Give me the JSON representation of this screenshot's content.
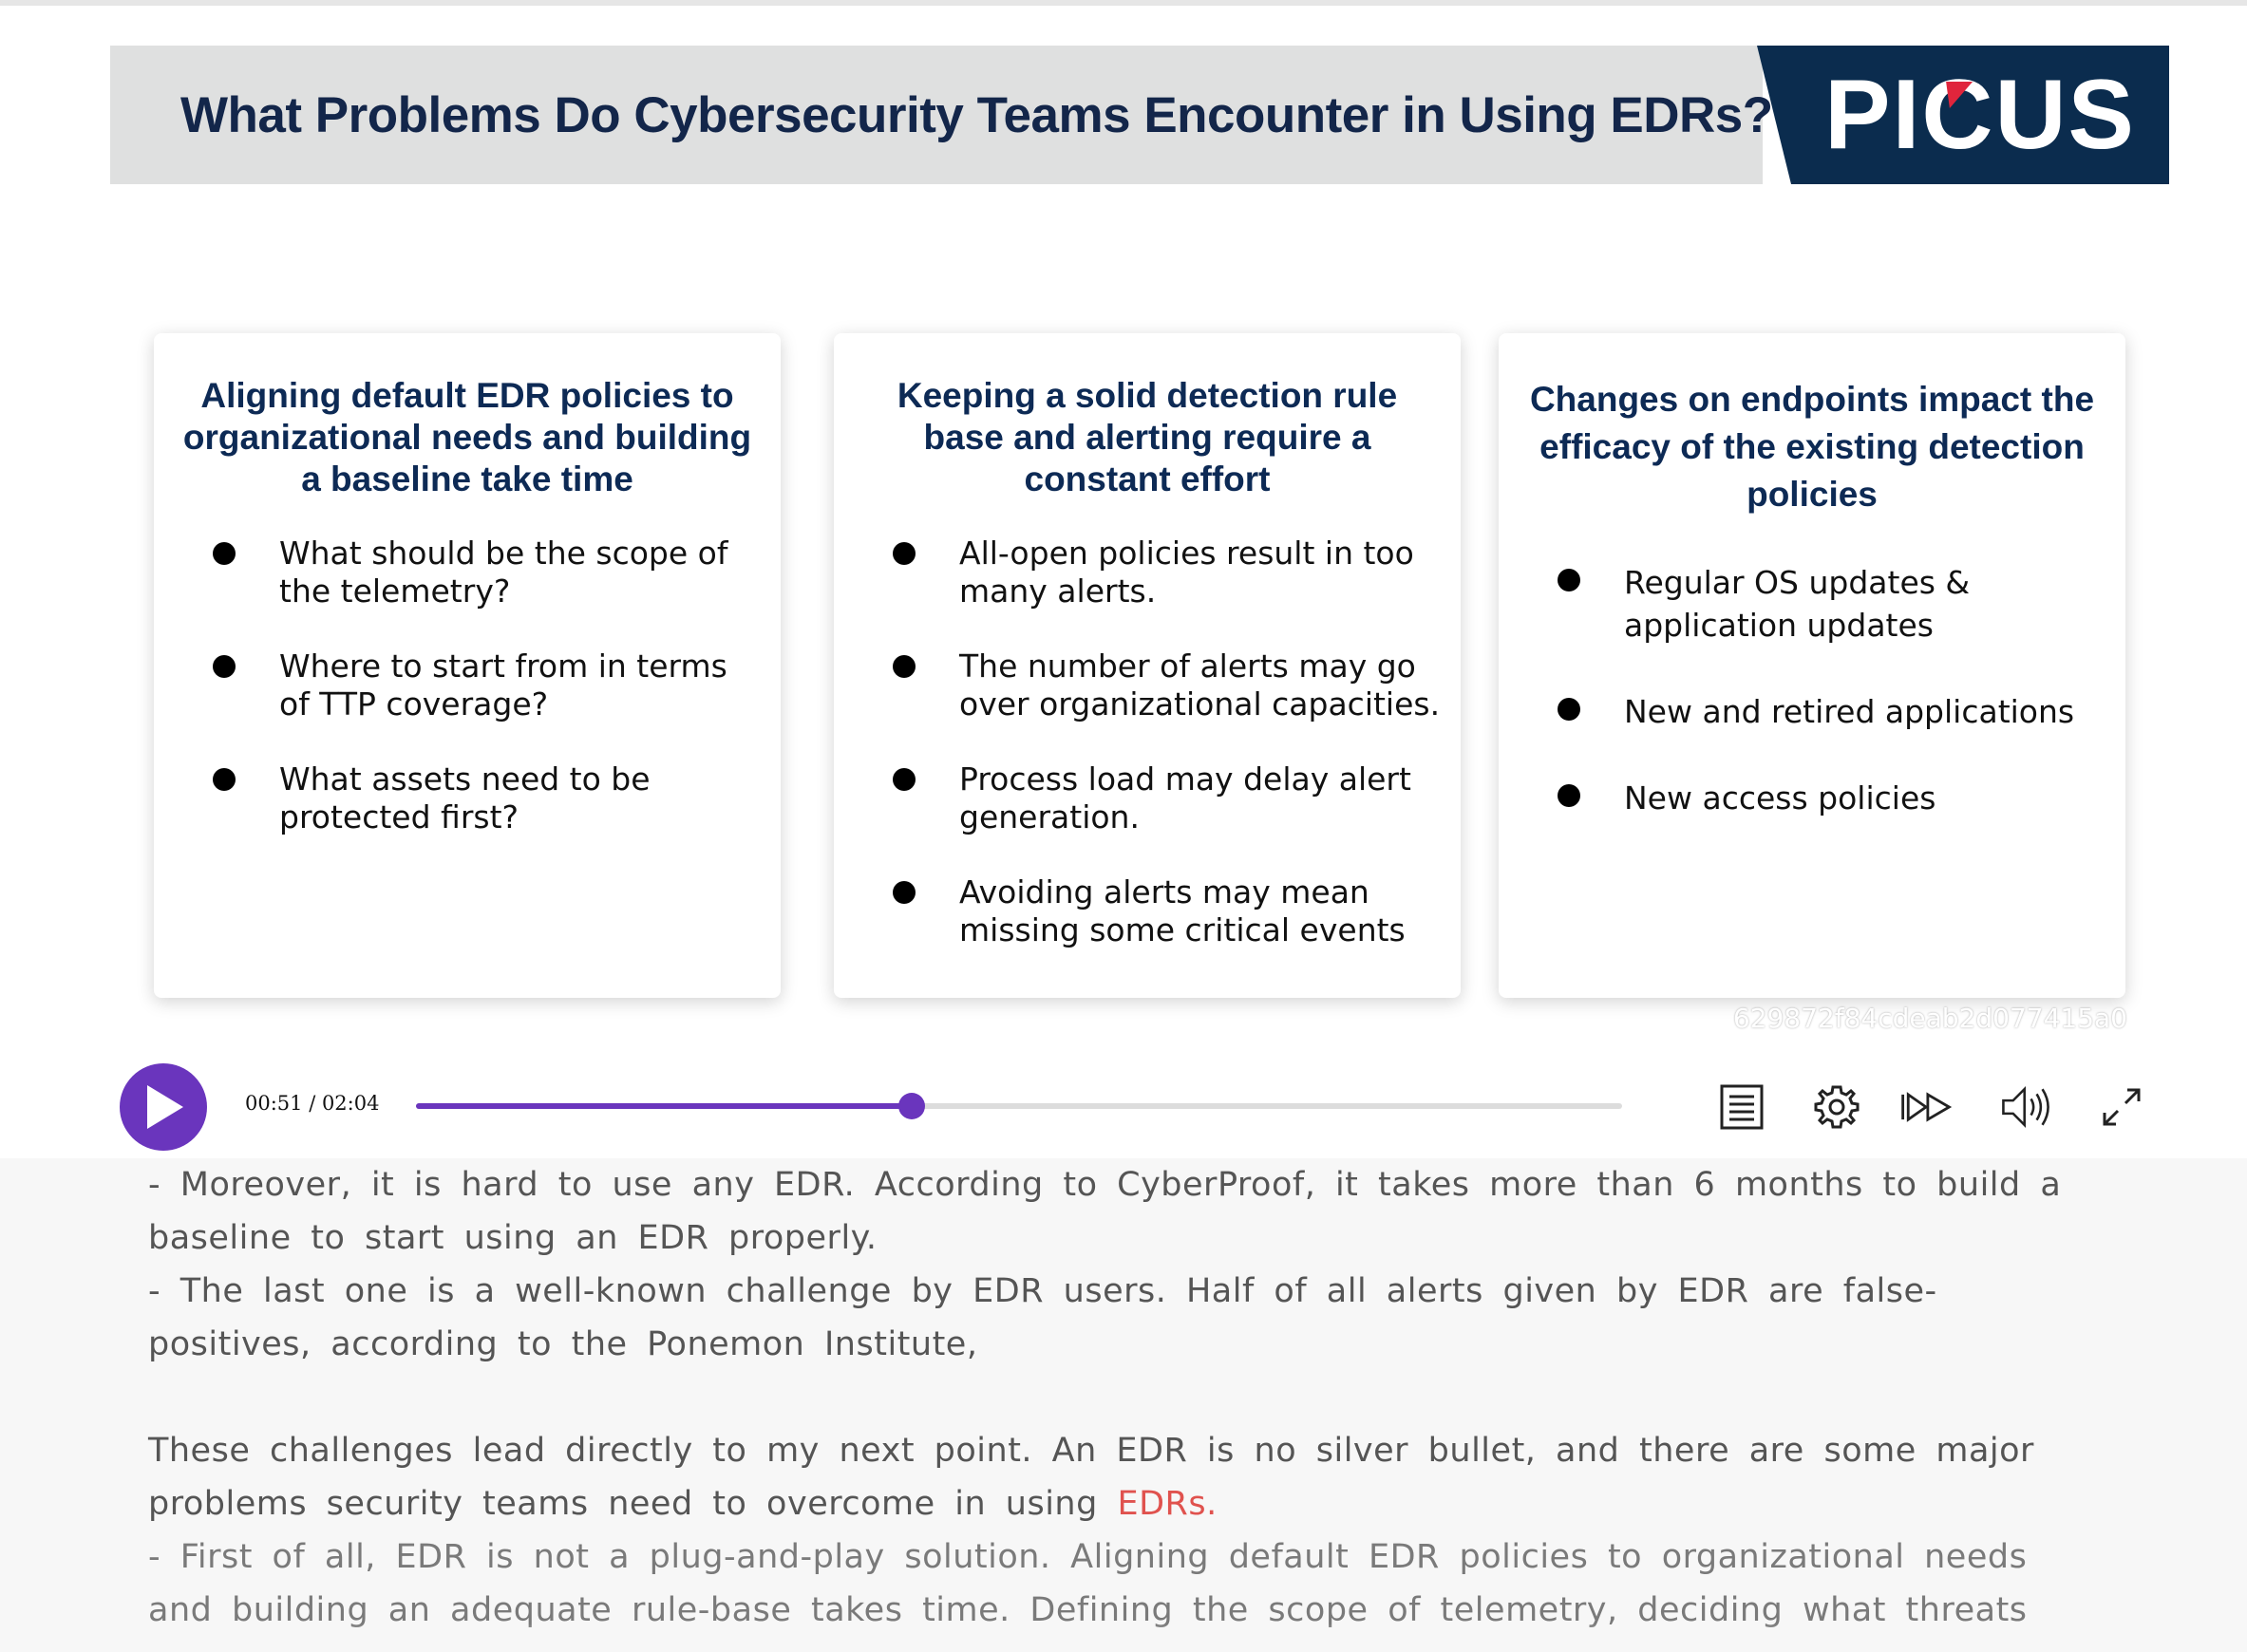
{
  "slide": {
    "title": "What Problems Do Cybersecurity Teams Encounter in Using EDRs?",
    "logo_text": "PICUS",
    "watermark": "629872f84cdeab2d077415a0",
    "colors": {
      "title_bar_bg": "#dfe0e0",
      "title_text": "#13264a",
      "logo_bg": "#0b2c4e",
      "logo_accent": "#e0253c",
      "card_heading": "#0d2a55"
    },
    "cards": [
      {
        "heading": "Aligning default EDR policies to organizational needs and building a baseline take time",
        "bullets": [
          "What should be the scope of the telemetry?",
          "Where to start from in terms of TTP coverage?",
          "What assets need to be protected first?"
        ]
      },
      {
        "heading": "Keeping a solid detection rule base and alerting require a constant effort",
        "bullets": [
          "All-open policies result in too many alerts.",
          " The number of alerts may go over organizational capacities.",
          "Process load may delay alert generation.",
          "Avoiding alerts may mean missing some critical events"
        ]
      },
      {
        "heading": "Changes on endpoints impact the efficacy of the existing detection policies",
        "bullets": [
          "Regular OS updates & application updates",
          "New and retired applications",
          "New access policies"
        ]
      }
    ]
  },
  "player": {
    "time_display": "00:51 / 02:04",
    "progress": 0.411,
    "accent_color": "#6a35bd",
    "icons": [
      "play-icon",
      "transcript-icon",
      "settings-gear-icon",
      "playback-speed-icon",
      "volume-icon",
      "fullscreen-icon"
    ]
  },
  "transcript": {
    "p1": "- Moreover,  it  is  hard  to  use  any  EDR.  According  to  CyberProof,  it  takes  more  than  6  months  to  build  a  baseline  to  start  using  an  EDR  properly.",
    "p2": "- The  last  one  is  a  well-known  challenge  by  EDR  users. Half  of  all  alerts  given  by  EDR  are  false-positives,  according  to  the  Ponemon  Institute,",
    "p3_before": "These  challenges  lead  directly  to  my  next  point.  An  EDR  is  no  silver  bullet,  and  there  are  some  major  problems  security  teams  need  to  overcome  in  using ",
    "p3_highlight": "EDRs.",
    "p4": "- First  of  all,  EDR  is  not  a  plug-and-play  solution.  Aligning  default  EDR  policies  to  organizational  needs  and  building  an  adequate  rule-base  takes  time.  Defining  the  scope  of  telemetry,  deciding  what  threats",
    "highlight_color": "#e0524e"
  }
}
